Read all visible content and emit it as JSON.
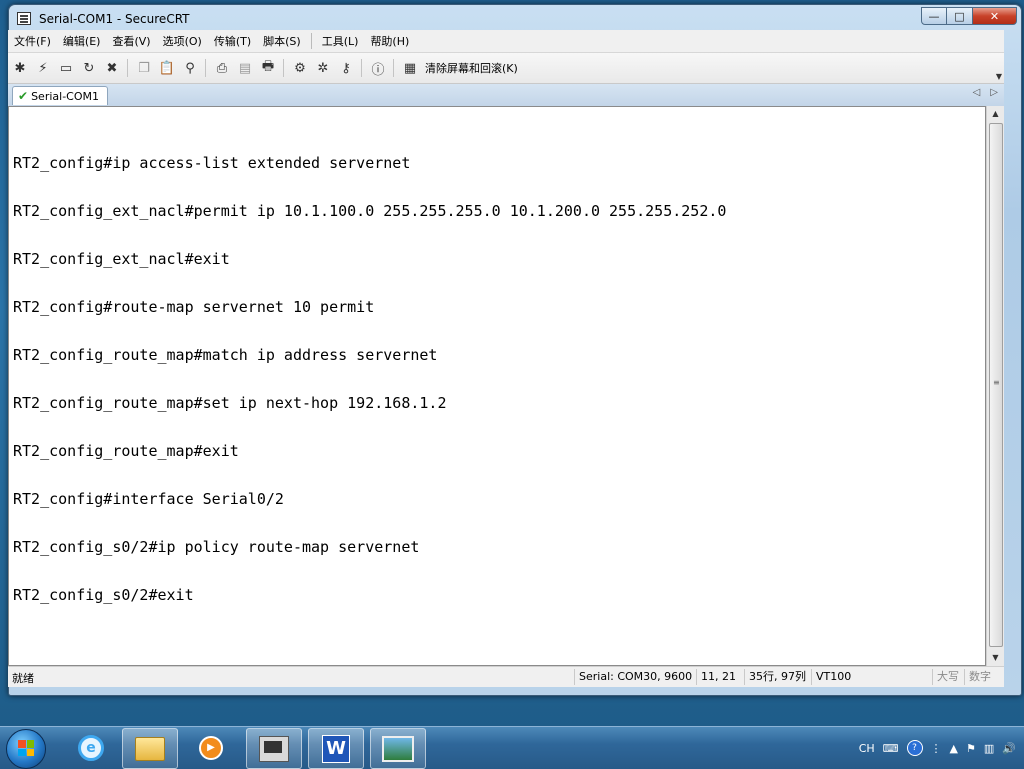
{
  "window": {
    "title": "Serial-COM1 - SecureCRT",
    "minimize_label": "—",
    "maximize_label": "□",
    "close_label": "✕"
  },
  "menu": {
    "items": [
      {
        "label": "文件(F)"
      },
      {
        "label": "编辑(E)"
      },
      {
        "label": "查看(V)"
      },
      {
        "label": "选项(O)"
      },
      {
        "label": "传输(T)"
      },
      {
        "label": "脚本(S)"
      },
      {
        "label": "工具(L)"
      },
      {
        "label": "帮助(H)"
      }
    ]
  },
  "toolbar": {
    "clear_label": "清除屏幕和回滚(K)"
  },
  "tabs": [
    {
      "label": "Serial-COM1",
      "active": true
    }
  ],
  "terminal": {
    "lines": [
      "RT2_config#ip access-list extended servernet",
      "RT2_config_ext_nacl#permit ip 10.1.100.0 255.255.255.0 10.1.200.0 255.255.252.0",
      "RT2_config_ext_nacl#exit",
      "RT2_config#route-map servernet 10 permit",
      "RT2_config_route_map#match ip address servernet",
      "RT2_config_route_map#set ip next-hop 192.168.1.2",
      "RT2_config_route_map#exit",
      "RT2_config#interface Serial0/2",
      "RT2_config_s0/2#ip policy route-map servernet",
      "RT2_config_s0/2#exit"
    ]
  },
  "statusbar": {
    "ready": "就绪",
    "connection": "Serial: COM30, 9600",
    "cursor": "11,  21",
    "size": "35行, 97列",
    "emulation": "VT100",
    "caps": "大写",
    "num": "数字"
  },
  "tray": {
    "lang": "CH"
  },
  "colors": {
    "accent": "#1f5f8f",
    "close_button": "#c8422a",
    "tab_check": "#2a9b2a"
  }
}
